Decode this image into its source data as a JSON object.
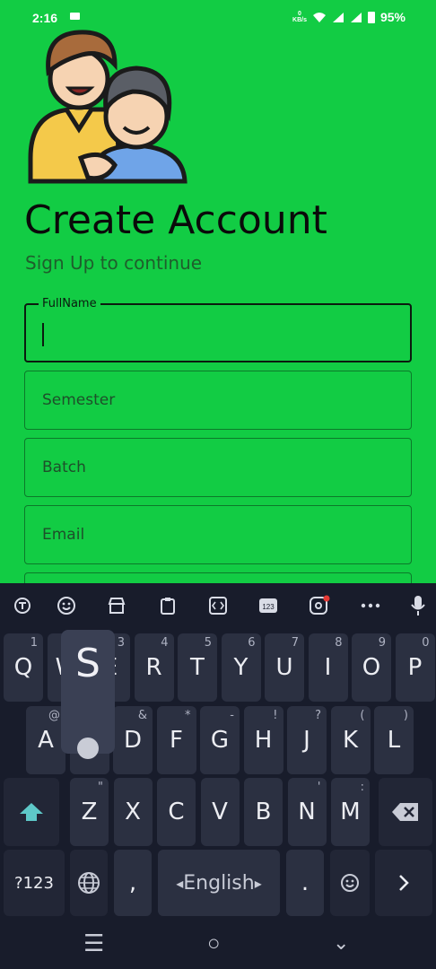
{
  "status_bar": {
    "time": "2:16",
    "net_speed_value": "0",
    "net_speed_unit": "KB/s",
    "battery": "95%"
  },
  "form": {
    "title": "Create Account",
    "subtitle": "Sign Up to continue",
    "fields": [
      {
        "label": "FullName",
        "placeholder": ""
      },
      {
        "label": "",
        "placeholder": "Semester"
      },
      {
        "label": "",
        "placeholder": "Batch"
      },
      {
        "label": "",
        "placeholder": "Email"
      }
    ]
  },
  "keyboard": {
    "toolbar_icons": [
      "translate-icon",
      "emoji-icon",
      "store-icon",
      "clipboard-icon",
      "text-edit-icon",
      "numpad-icon",
      "assistant-icon",
      "more-icon",
      "mic-icon"
    ],
    "row1": [
      {
        "key": "Q",
        "hint": "1"
      },
      {
        "key": "W",
        "hint": "2"
      },
      {
        "key": "E",
        "hint": "3"
      },
      {
        "key": "R",
        "hint": "4"
      },
      {
        "key": "T",
        "hint": "5"
      },
      {
        "key": "Y",
        "hint": "6"
      },
      {
        "key": "U",
        "hint": "7"
      },
      {
        "key": "I",
        "hint": "8"
      },
      {
        "key": "O",
        "hint": "9"
      },
      {
        "key": "P",
        "hint": "0"
      }
    ],
    "row2": [
      {
        "key": "A",
        "hint": "@"
      },
      {
        "key": "S",
        "hint": "#"
      },
      {
        "key": "D",
        "hint": "&"
      },
      {
        "key": "F",
        "hint": "*"
      },
      {
        "key": "G",
        "hint": "-"
      },
      {
        "key": "H",
        "hint": "!"
      },
      {
        "key": "J",
        "hint": "?"
      },
      {
        "key": "K",
        "hint": "("
      },
      {
        "key": "L",
        "hint": ")"
      }
    ],
    "row3": [
      {
        "key": "Z",
        "hint": "\""
      },
      {
        "key": "X",
        "hint": ""
      },
      {
        "key": "C",
        "hint": ""
      },
      {
        "key": "V",
        "hint": ""
      },
      {
        "key": "B",
        "hint": ""
      },
      {
        "key": "N",
        "hint": "'"
      },
      {
        "key": "M",
        "hint": ":"
      }
    ],
    "row3_hint_extra": "/",
    "popup_letter": "S",
    "symbols_key": "?123",
    "comma_key": ",",
    "space_label": "English",
    "period_key": ".",
    "accent_color": "#5ec8c8"
  }
}
